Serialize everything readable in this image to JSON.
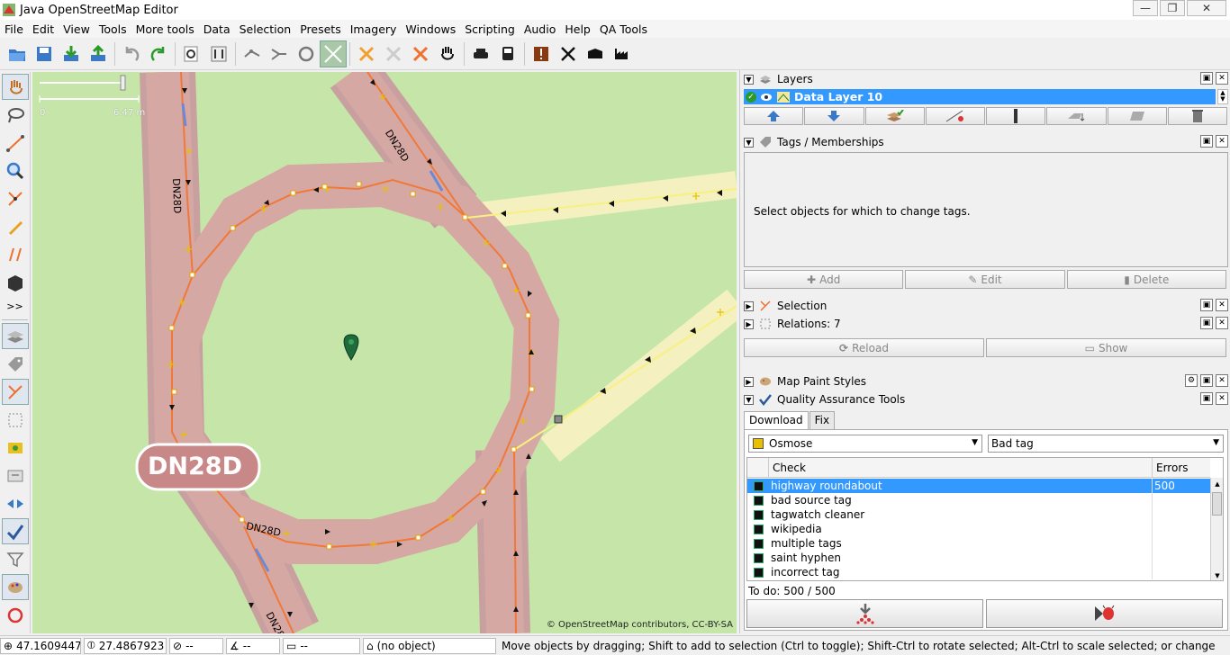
{
  "window": {
    "title": "Java OpenStreetMap Editor"
  },
  "menu": [
    "File",
    "Edit",
    "View",
    "Tools",
    "More tools",
    "Data",
    "Selection",
    "Presets",
    "Imagery",
    "Windows",
    "Scripting",
    "Audio",
    "Help",
    "QA Tools"
  ],
  "left_tools": {
    "more_label": ">>"
  },
  "map": {
    "scale_start": "0",
    "scale_end": "6.47 m",
    "road_ref": "DN28D",
    "shield_text": "DN28D",
    "attribution": "© OpenStreetMap contributors, CC-BY-SA"
  },
  "layers": {
    "title": "Layers",
    "rows": [
      {
        "name": "Data Layer 10"
      }
    ]
  },
  "tags": {
    "title": "Tags / Memberships",
    "empty_message": "Select objects for which to change tags.",
    "add_label": "Add",
    "edit_label": "Edit",
    "delete_label": "Delete"
  },
  "selection": {
    "title": "Selection"
  },
  "relations": {
    "title": "Relations: 7",
    "reload_label": "Reload",
    "show_label": "Show"
  },
  "map_paint": {
    "title": "Map Paint Styles"
  },
  "qa": {
    "title": "Quality Assurance Tools",
    "tabs": [
      "Download",
      "Fix"
    ],
    "source": "Osmose",
    "filter": "Bad tag",
    "columns": [
      "Check",
      "Errors"
    ],
    "rows": [
      {
        "check": "highway roundabout",
        "errors": "500"
      },
      {
        "check": "bad source tag",
        "errors": ""
      },
      {
        "check": "tagwatch cleaner",
        "errors": ""
      },
      {
        "check": "wikipedia",
        "errors": ""
      },
      {
        "check": "multiple tags",
        "errors": ""
      },
      {
        "check": "saint hyphen",
        "errors": ""
      },
      {
        "check": "incorrect tag",
        "errors": ""
      }
    ],
    "todo": "To do: 500 / 500"
  },
  "status": {
    "lat": "47.1609447",
    "lon": "27.4867923",
    "heading": "--",
    "angle": "--",
    "length": "--",
    "object": "(no object)",
    "help": "Move objects by dragging; Shift to add to selection (Ctrl to toggle); Shift-Ctrl to rotate selected; Alt-Ctrl to scale selected; or change selection"
  }
}
